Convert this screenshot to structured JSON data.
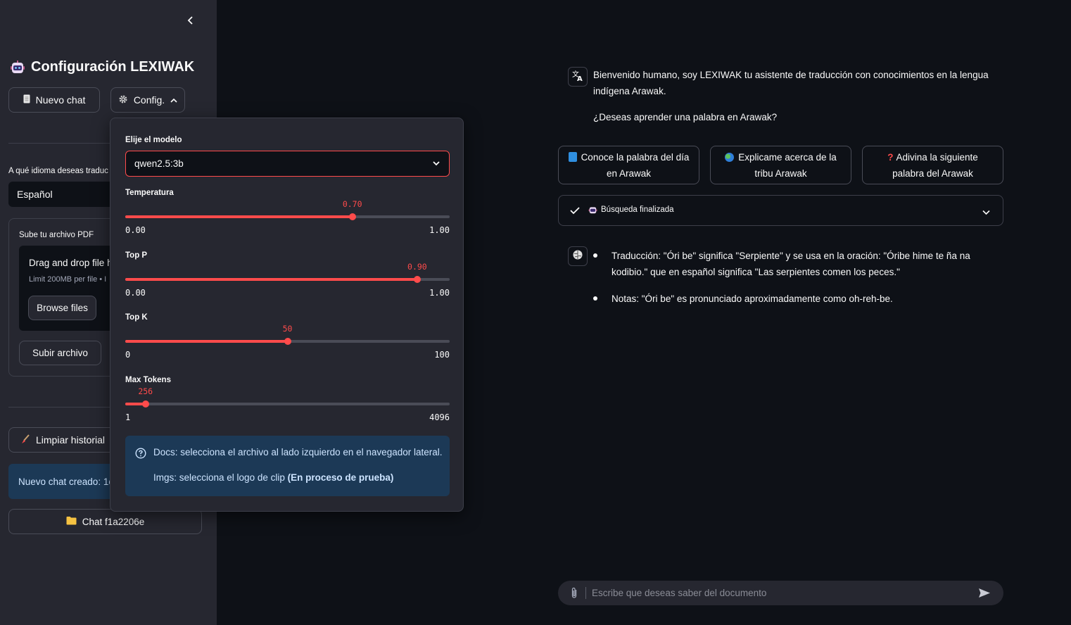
{
  "sidebar": {
    "title": "Configuración LEXIWAK",
    "new_chat_label": "Nuevo chat",
    "config_label": "Config.",
    "language_label": "A qué idioma deseas traduc",
    "language_value": "Español",
    "upload_label": "Sube tu archivo PDF",
    "drop_title": "Drag and drop file h",
    "drop_limit": "Limit 200MB per file • I",
    "browse_label": "Browse files",
    "submit_label": "Subir archivo",
    "clear_label": "Limpiar historial",
    "info_text": "Nuevo chat creado: 1c",
    "chat_item_label": "Chat f1a2206e"
  },
  "config_popover": {
    "model_label": "Elije el modelo",
    "model_value": "qwen2.5:3b",
    "sliders": [
      {
        "label": "Temperatura",
        "value_text": "0.70",
        "min_text": "0.00",
        "max_text": "1.00",
        "min": 0,
        "max": 1,
        "value": 0.7
      },
      {
        "label": "Top P",
        "value_text": "0.90",
        "min_text": "0.00",
        "max_text": "1.00",
        "min": 0,
        "max": 1,
        "value": 0.9
      },
      {
        "label": "Top K",
        "value_text": "50",
        "min_text": "0",
        "max_text": "100",
        "min": 0,
        "max": 100,
        "value": 50
      },
      {
        "label": "Max Tokens",
        "value_text": "256",
        "min_text": "1",
        "max_text": "4096",
        "min": 1,
        "max": 4096,
        "value": 256
      }
    ],
    "info_line1": "Docs: selecciona el archivo al lado izquierdo en el navegador lateral.",
    "info_line2_prefix": "Imgs: selecciona el logo de clip ",
    "info_line2_bold": "(En proceso de prueba)"
  },
  "main": {
    "welcome_line1": "Bienvenido humano, soy LEXIWAK tu asistente de traducción con conocimientos en la lengua",
    "welcome_line2": "indígena Arawak.",
    "welcome_question": "¿Deseas aprender una palabra en Arawak?",
    "suggestions": [
      {
        "line1": "Conoce la palabra del día",
        "line2": "en Arawak"
      },
      {
        "line1": "Explicame acerca de la",
        "line2": "tribu Arawak"
      },
      {
        "line1": "Adivina la siguiente",
        "line2": "palabra del Arawak"
      }
    ],
    "status_text": "Búsqueda finalizada",
    "answer_b1_line1": "Traducción: \"Óri be\" significa \"Serpiente\" y se usa en la oración: \"Óribe hime te ña na",
    "answer_b1_line2": "kodibio.\" que en español significa \"Las serpientes comen los peces.\"",
    "answer_b2": "Notas: \"Óri be\" es pronunciado aproximadamente como oh-reh-be.",
    "input_placeholder": "Escribe que deseas saber del documento"
  },
  "colors": {
    "accent": "#ff4b4b",
    "info_bg": "#1c3956",
    "sidebar_bg": "#262730",
    "main_bg": "#0e1117"
  }
}
